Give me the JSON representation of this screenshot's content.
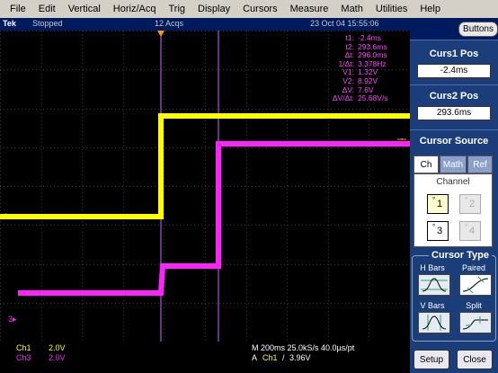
{
  "menu": [
    "File",
    "Edit",
    "Vertical",
    "Horiz/Acq",
    "Trig",
    "Display",
    "Cursors",
    "Measure",
    "Math",
    "Utilities",
    "Help"
  ],
  "status": {
    "brand": "Tek",
    "state": "Stopped",
    "acqs": "12 Acqs",
    "datetime": "23 Oct 04  15:55:06"
  },
  "buttons_label": "Buttons",
  "readouts": [
    {
      "label": "t1:",
      "value": "-2.4ms"
    },
    {
      "label": "t2:",
      "value": "293.6ms"
    },
    {
      "label": "Δt:",
      "value": "296.0ms"
    },
    {
      "label": "1/Δt:",
      "value": "3.378Hz"
    },
    {
      "label": "V1:",
      "value": "1.32V"
    },
    {
      "label": "V2:",
      "value": "8.92V"
    },
    {
      "label": "ΔV:",
      "value": "7.6V"
    },
    {
      "label": "ΔV/Δt:",
      "value": "25.68V/s"
    }
  ],
  "markers": {
    "ch1": "1",
    "ch3": "3"
  },
  "bottom": {
    "ch1_label": "Ch1",
    "ch1_scale": "2.0V",
    "ch3_label": "Ch3",
    "ch3_scale": "2.0V",
    "horizontal": "M 200ms  25.0kS/s  40.0µs/pt",
    "trigger_mode": "A",
    "trigger_src": "Ch1",
    "trigger_slope": "/",
    "trigger_level": "3.96V"
  },
  "panel": {
    "curs1_title": "Curs1 Pos",
    "curs1_value": "-2.4ms",
    "curs2_title": "Curs2 Pos",
    "curs2_value": "293.6ms",
    "source_title": "Cursor Source",
    "tabs": [
      "Ch",
      "Math",
      "Ref"
    ],
    "channel_label": "Channel",
    "channels": [
      "1",
      "2",
      "3",
      "4"
    ],
    "type_title": "Cursor Type",
    "hbars": "H Bars",
    "paired": "Paired",
    "vbars": "V Bars",
    "split": "Split",
    "setup": "Setup",
    "close": "Close"
  },
  "colors": {
    "ch1": "#ffff00",
    "ch3": "#ff22ff",
    "cursor": "#cc66ff",
    "panel": "#1b3e7a",
    "statusbar": "#001a5e"
  }
}
